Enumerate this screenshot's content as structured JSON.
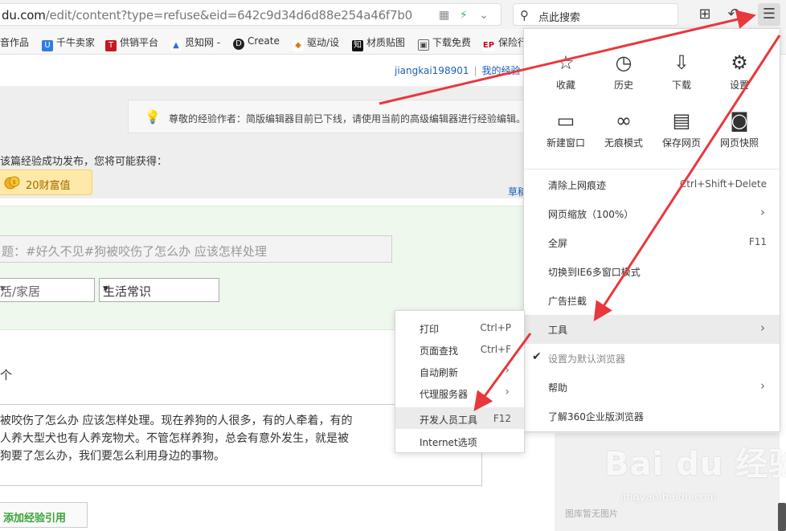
{
  "address_bar": {
    "url_visible": "du.com",
    "url_rest": "/edit/content?type=refuse&eid=642c9d34d6d88e254a46f7b0"
  },
  "search": {
    "text": "点此搜索"
  },
  "bookmarks": [
    {
      "label": "音作品",
      "icon": ""
    },
    {
      "label": "千牛卖家",
      "icon": "U"
    },
    {
      "label": "供销平台",
      "icon": "T"
    },
    {
      "label": "觅知网 -",
      "icon": "▲"
    },
    {
      "label": "Create",
      "icon": "D"
    },
    {
      "label": "驱动/设",
      "icon": "◆"
    },
    {
      "label": "材质贴图",
      "icon": "知"
    },
    {
      "label": "下载免费",
      "icon": "▣"
    },
    {
      "label": "保险行",
      "icon": "EP"
    }
  ],
  "header_links": {
    "username": "jiangkai198901",
    "my_experience": "我的经验"
  },
  "notice": {
    "text": "尊敬的经验作者：简版编辑器目前已下线，请使用当前的高级编辑器进行经验编辑。"
  },
  "reward": {
    "title": "该篇经验成功发布，您将可能获得：",
    "badge": "20财富值"
  },
  "draft_link": "草稿",
  "title_field": {
    "placeholder": "题：#好久不见#狗被咬伤了怎么办 应该怎样处理"
  },
  "category": {
    "first": "活/家居",
    "second": "生活常识"
  },
  "section_mark": "个",
  "intro_text": [
    "被咬伤了怎么办 应该怎样处理。现在养狗的人很多，有的人牵着，有的",
    "人养大型犬也有人养宠物犬。不管怎样养狗，总会有意外发生，就是被",
    "狗要了怎么办，我们要怎么利用身边的事物。"
  ],
  "add_reference": "添加经验引用",
  "main_menu": {
    "tiles": [
      {
        "label": "收藏",
        "icon": "star-icon",
        "glyph": "☆"
      },
      {
        "label": "历史",
        "icon": "clock-icon",
        "glyph": "◷"
      },
      {
        "label": "下载",
        "icon": "download-icon",
        "glyph": "⇩"
      },
      {
        "label": "设置",
        "icon": "gear-icon",
        "glyph": "⚙"
      },
      {
        "label": "新建窗口",
        "icon": "window-icon",
        "glyph": "▭"
      },
      {
        "label": "无痕模式",
        "icon": "incognito-icon",
        "glyph": "∞"
      },
      {
        "label": "保存网页",
        "icon": "save-icon",
        "glyph": "▤"
      },
      {
        "label": "网页快照",
        "icon": "camera-icon",
        "glyph": "◙"
      }
    ],
    "items": [
      {
        "label": "清除上网痕迹",
        "shortcut": "Ctrl+Shift+Delete"
      },
      {
        "label": "网页缩放（100%）",
        "arrow": "›"
      },
      {
        "label": "全屏",
        "shortcut": "F11"
      },
      {
        "label": "切换到IE6多窗口模式"
      },
      {
        "label": "广告拦截"
      },
      {
        "label": "工具",
        "arrow": "›"
      },
      {
        "label": "设置为默认浏览器",
        "check": "✔"
      },
      {
        "label": "帮助",
        "arrow": "›"
      },
      {
        "label": "了解360企业版浏览器"
      }
    ]
  },
  "tools_submenu": {
    "items": [
      {
        "label": "打印",
        "shortcut": "Ctrl+P"
      },
      {
        "label": "页面查找",
        "shortcut": "Ctrl+F"
      },
      {
        "label": "自动刷新",
        "arrow": "›"
      },
      {
        "label": "代理服务器",
        "arrow": "›"
      },
      {
        "label": "开发人员工具",
        "shortcut": "F12"
      },
      {
        "label": "Internet选项"
      }
    ]
  },
  "watermark": {
    "brand": "Bai du 经验",
    "domain": "jingyan.baidu.com"
  },
  "no_image_text": "图库暂无图片",
  "colors": {
    "annotation_arrow": "#e8383d",
    "link": "#1a5fb4",
    "reward_bg": "#ffe9a8"
  }
}
